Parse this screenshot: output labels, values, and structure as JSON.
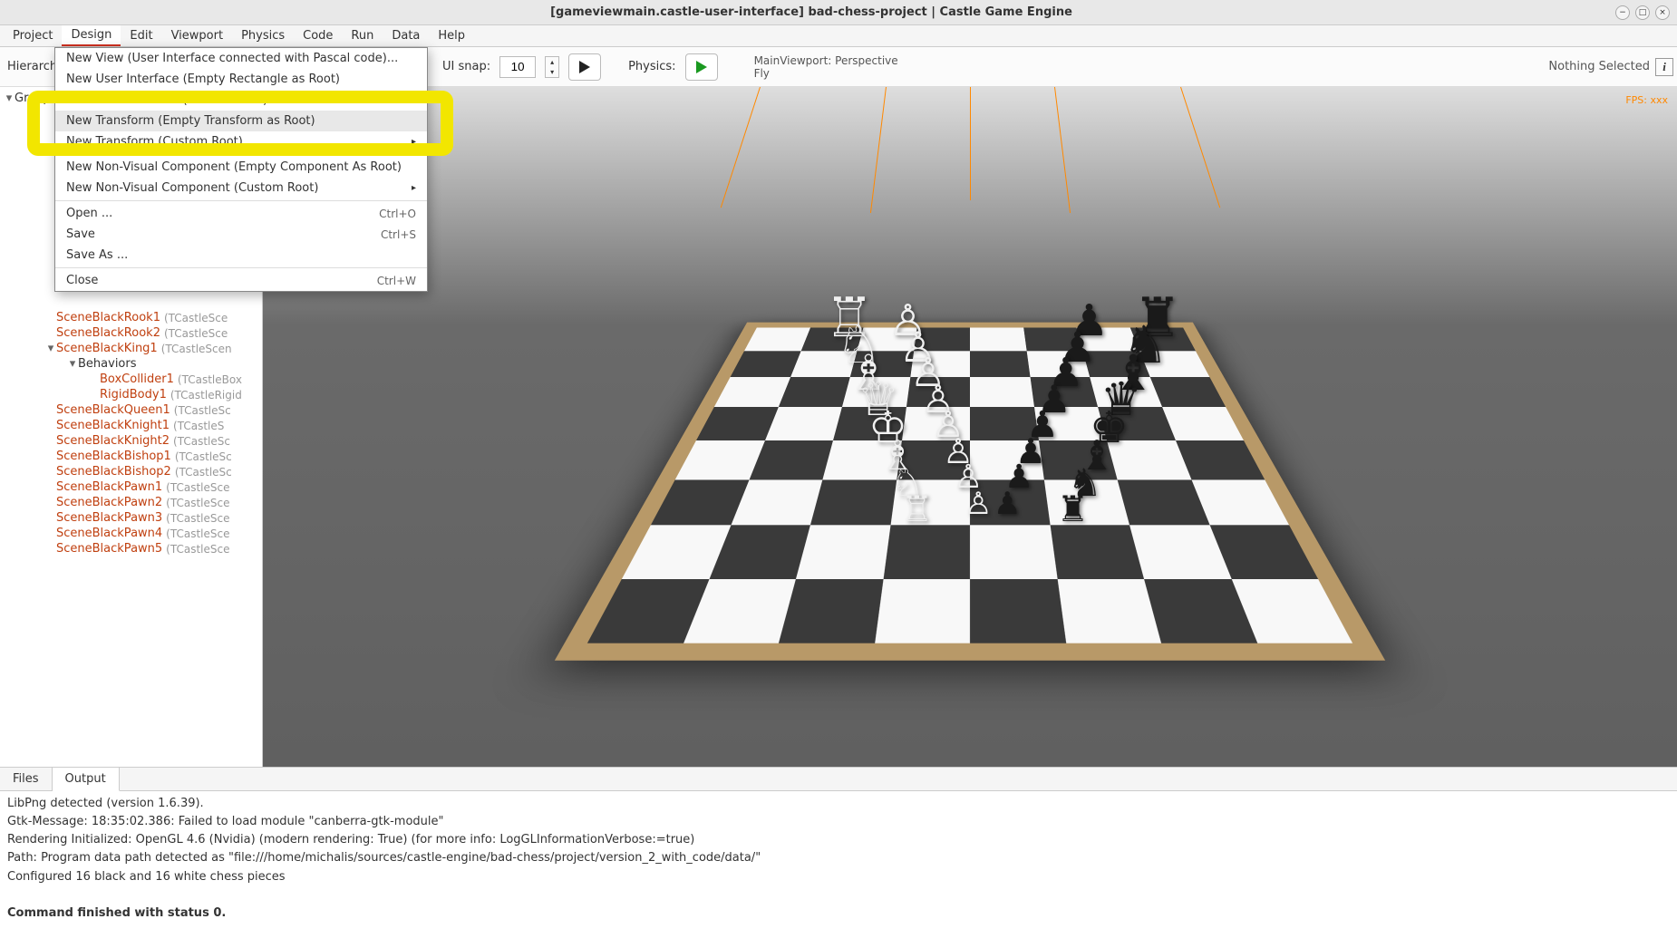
{
  "titlebar": {
    "title": "[gameviewmain.castle-user-interface] bad-chess-project | Castle Game Engine"
  },
  "menubar": {
    "items": [
      "Project",
      "Design",
      "Edit",
      "Viewport",
      "Physics",
      "Code",
      "Run",
      "Data",
      "Help"
    ],
    "active": "Design"
  },
  "toolbar": {
    "hierarchy_label": "Hierarchy",
    "group_label": "Group",
    "ui_snap_label": "UI snap:",
    "ui_snap_value": "10",
    "physics_label": "Physics:",
    "viewport_info_line1": "MainViewport: Perspective",
    "viewport_info_line2": "Fly",
    "selection": "Nothing Selected"
  },
  "dropdown": {
    "items": [
      {
        "label": "New View (User Interface connected with Pascal code)...",
        "shortcut": "",
        "arrow": false
      },
      {
        "label": "New User Interface (Empty Rectangle as Root)",
        "shortcut": "",
        "arrow": false
      },
      {
        "label": "New User Interface (Custom Root)",
        "shortcut": "",
        "arrow": true,
        "highlighted": true
      },
      {
        "label": "New Transform (Empty Transform as Root)",
        "shortcut": "",
        "arrow": false,
        "highlighted": true,
        "hovered": true
      },
      {
        "label": "New Transform (Custom Root)",
        "shortcut": "",
        "arrow": true,
        "highlighted": true
      },
      {
        "sep": true
      },
      {
        "label": "New Non-Visual Component (Empty Component As Root)",
        "shortcut": "",
        "arrow": false
      },
      {
        "label": "New Non-Visual Component (Custom Root)",
        "shortcut": "",
        "arrow": true
      },
      {
        "sep": true
      },
      {
        "label": "Open ...",
        "shortcut": "Ctrl+O",
        "arrow": false
      },
      {
        "label": "Save",
        "shortcut": "Ctrl+S",
        "arrow": false
      },
      {
        "label": "Save As ...",
        "shortcut": "",
        "arrow": false
      },
      {
        "sep": true
      },
      {
        "label": "Close",
        "shortcut": "Ctrl+W",
        "arrow": false
      }
    ]
  },
  "tree": {
    "items": [
      {
        "name": "SceneBlackRook1",
        "type": "(TCastleSce",
        "indent": 3
      },
      {
        "name": "SceneBlackRook2",
        "type": "(TCastleSce",
        "indent": 3
      },
      {
        "name": "SceneBlackKing1",
        "type": "(TCastleScen",
        "indent": 3,
        "toggle": "▾"
      },
      {
        "name": "Behaviors",
        "type": "",
        "indent": 4,
        "toggle": "▾",
        "plain": true
      },
      {
        "name": "BoxCollider1",
        "type": "(TCastleBox",
        "indent": 5
      },
      {
        "name": "RigidBody1",
        "type": "(TCastleRigid",
        "indent": 5
      },
      {
        "name": "SceneBlackQueen1",
        "type": "(TCastleSc",
        "indent": 3
      },
      {
        "name": "SceneBlackKnight1",
        "type": "(TCastleS",
        "indent": 3
      },
      {
        "name": "SceneBlackKnight2",
        "type": "(TCastleSc",
        "indent": 3
      },
      {
        "name": "SceneBlackBishop1",
        "type": "(TCastleSc",
        "indent": 3
      },
      {
        "name": "SceneBlackBishop2",
        "type": "(TCastleSc",
        "indent": 3
      },
      {
        "name": "SceneBlackPawn1",
        "type": "(TCastleSce",
        "indent": 3
      },
      {
        "name": "SceneBlackPawn2",
        "type": "(TCastleSce",
        "indent": 3
      },
      {
        "name": "SceneBlackPawn3",
        "type": "(TCastleSce",
        "indent": 3
      },
      {
        "name": "SceneBlackPawn4",
        "type": "(TCastleSce",
        "indent": 3
      },
      {
        "name": "SceneBlackPawn5",
        "type": "(TCastleSce",
        "indent": 3
      }
    ]
  },
  "viewport": {
    "fps": "FPS: xxx"
  },
  "tabs": {
    "items": [
      "Files",
      "Output"
    ],
    "active": "Output"
  },
  "output": {
    "lines": [
      "LibPng detected (version 1.6.39).",
      "Gtk-Message: 18:35:02.386: Failed to load module \"canberra-gtk-module\"",
      "Rendering Initialized: OpenGL 4.6 (Nvidia) (modern rendering: True) (for more info: LogGLInformationVerbose:=true)",
      "Path: Program data path detected as \"file:///home/michalis/sources/castle-engine/bad-chess/project/version_2_with_code/data/\"",
      "Configured 16 black and 16 white chess pieces",
      "",
      "Command finished with status 0."
    ]
  }
}
